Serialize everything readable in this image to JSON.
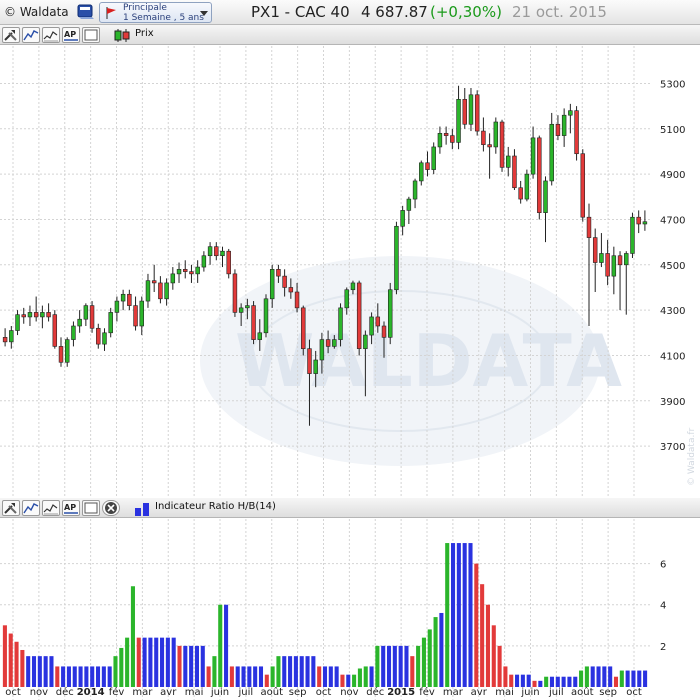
{
  "app": {
    "brand": "© Waldata",
    "scope_line1": "Principale",
    "scope_line2": "1 Semaine , 5 ans",
    "symbol": "PX1 - CAC 40",
    "last": "4 687.87",
    "change": "(+0,30%)",
    "date": "21 oct. 2015"
  },
  "toolbar_top": {
    "legend_label": "Prix"
  },
  "toolbar_bottom": {
    "legend_label": "Indicateur Ratio H/B(14)"
  },
  "watermark": {
    "text": "WALDATA",
    "copyright": "© Waldata.fr"
  },
  "colors": {
    "up": "#2bb52b",
    "down": "#e23a3a",
    "ratio_up": "#2bb52b",
    "ratio_down": "#e23a3a",
    "ratio_neutral": "#2a32e0",
    "accent_change": "#1a9a1a"
  },
  "icons": [
    "hammer-wrench-icon",
    "line-chart-icon",
    "indicator-chart-icon",
    "ap-text-icon",
    "blank-box-icon",
    "close-circle-icon",
    "book-icon",
    "flag-icon"
  ],
  "chart_data": [
    {
      "type": "candlestick",
      "title": "PX1 - CAC 40",
      "series_name": "Prix",
      "y_ticks": [
        3700,
        3900,
        4100,
        4300,
        4500,
        4700,
        4900,
        5100,
        5300
      ],
      "ylim": [
        3480,
        5430
      ],
      "grid": true,
      "x_tick_labels": [
        "oct",
        "nov",
        "déc",
        "2014",
        "fév",
        "mar",
        "avr",
        "mai",
        "juin",
        "juil",
        "août",
        "sep",
        "oct",
        "nov",
        "déc",
        "2015",
        "fév",
        "mar",
        "avr",
        "mai",
        "juin",
        "juil",
        "août",
        "sep",
        "oct"
      ],
      "candles": [
        [
          4180,
          4220,
          4140,
          4160
        ],
        [
          4160,
          4230,
          4130,
          4210
        ],
        [
          4210,
          4300,
          4190,
          4280
        ],
        [
          4280,
          4310,
          4240,
          4270
        ],
        [
          4270,
          4320,
          4230,
          4290
        ],
        [
          4290,
          4360,
          4250,
          4270
        ],
        [
          4270,
          4320,
          4220,
          4290
        ],
        [
          4290,
          4330,
          4250,
          4270
        ],
        [
          4280,
          4300,
          4130,
          4140
        ],
        [
          4140,
          4180,
          4050,
          4070
        ],
        [
          4070,
          4180,
          4050,
          4170
        ],
        [
          4170,
          4250,
          4140,
          4230
        ],
        [
          4230,
          4300,
          4200,
          4260
        ],
        [
          4260,
          4330,
          4230,
          4320
        ],
        [
          4320,
          4340,
          4200,
          4220
        ],
        [
          4220,
          4240,
          4130,
          4150
        ],
        [
          4150,
          4220,
          4120,
          4200
        ],
        [
          4200,
          4310,
          4180,
          4290
        ],
        [
          4290,
          4360,
          4250,
          4340
        ],
        [
          4340,
          4390,
          4300,
          4370
        ],
        [
          4370,
          4390,
          4300,
          4320
        ],
        [
          4320,
          4360,
          4210,
          4230
        ],
        [
          4230,
          4360,
          4190,
          4340
        ],
        [
          4340,
          4460,
          4310,
          4430
        ],
        [
          4430,
          4500,
          4380,
          4420
        ],
        [
          4420,
          4450,
          4330,
          4350
        ],
        [
          4350,
          4440,
          4320,
          4420
        ],
        [
          4420,
          4490,
          4390,
          4460
        ],
        [
          4460,
          4510,
          4420,
          4480
        ],
        [
          4480,
          4520,
          4440,
          4470
        ],
        [
          4470,
          4500,
          4420,
          4460
        ],
        [
          4460,
          4520,
          4420,
          4490
        ],
        [
          4490,
          4560,
          4470,
          4540
        ],
        [
          4540,
          4600,
          4500,
          4580
        ],
        [
          4580,
          4600,
          4520,
          4540
        ],
        [
          4540,
          4580,
          4490,
          4560
        ],
        [
          4560,
          4570,
          4440,
          4460
        ],
        [
          4460,
          4480,
          4270,
          4290
        ],
        [
          4290,
          4330,
          4230,
          4310
        ],
        [
          4310,
          4350,
          4260,
          4320
        ],
        [
          4320,
          4340,
          4150,
          4170
        ],
        [
          4170,
          4260,
          4120,
          4200
        ],
        [
          4200,
          4370,
          4180,
          4350
        ],
        [
          4350,
          4500,
          4310,
          4480
        ],
        [
          4480,
          4500,
          4420,
          4450
        ],
        [
          4450,
          4480,
          4360,
          4400
        ],
        [
          4400,
          4440,
          4350,
          4380
        ],
        [
          4380,
          4420,
          4290,
          4310
        ],
        [
          4310,
          4320,
          4100,
          4130
        ],
        [
          4130,
          4170,
          3790,
          4020
        ],
        [
          4020,
          4120,
          3960,
          4080
        ],
        [
          4080,
          4200,
          4020,
          4170
        ],
        [
          4170,
          4210,
          4110,
          4140
        ],
        [
          4140,
          4190,
          4130,
          4170
        ],
        [
          4170,
          4330,
          4140,
          4310
        ],
        [
          4310,
          4400,
          4280,
          4390
        ],
        [
          4390,
          4430,
          4370,
          4420
        ],
        [
          4420,
          4430,
          4100,
          4130
        ],
        [
          4130,
          4210,
          3920,
          4190
        ],
        [
          4190,
          4290,
          4150,
          4270
        ],
        [
          4270,
          4330,
          4200,
          4230
        ],
        [
          4230,
          4250,
          4090,
          4180
        ],
        [
          4180,
          4420,
          4150,
          4390
        ],
        [
          4390,
          4690,
          4370,
          4670
        ],
        [
          4670,
          4760,
          4630,
          4740
        ],
        [
          4740,
          4800,
          4680,
          4790
        ],
        [
          4790,
          4880,
          4750,
          4870
        ],
        [
          4870,
          4960,
          4850,
          4950
        ],
        [
          4950,
          5000,
          4890,
          4920
        ],
        [
          4920,
          5040,
          4900,
          5020
        ],
        [
          5020,
          5110,
          4990,
          5080
        ],
        [
          5080,
          5110,
          5030,
          5070
        ],
        [
          5070,
          5100,
          5010,
          5040
        ],
        [
          5040,
          5290,
          5010,
          5230
        ],
        [
          5230,
          5280,
          5100,
          5120
        ],
        [
          5120,
          5280,
          5090,
          5250
        ],
        [
          5250,
          5270,
          5070,
          5090
        ],
        [
          5090,
          5150,
          5000,
          5030
        ],
        [
          5030,
          5080,
          4880,
          5020
        ],
        [
          5020,
          5150,
          4990,
          5130
        ],
        [
          5130,
          5140,
          4910,
          4930
        ],
        [
          4930,
          5020,
          4890,
          4980
        ],
        [
          4980,
          5010,
          4830,
          4840
        ],
        [
          4840,
          4870,
          4770,
          4790
        ],
        [
          4790,
          4920,
          4780,
          4900
        ],
        [
          4900,
          5110,
          4880,
          5060
        ],
        [
          5060,
          5070,
          4700,
          4730
        ],
        [
          4730,
          4890,
          4600,
          4870
        ],
        [
          4870,
          5170,
          4850,
          5120
        ],
        [
          5120,
          5160,
          5050,
          5070
        ],
        [
          5070,
          5190,
          5020,
          5160
        ],
        [
          5160,
          5210,
          5080,
          5180
        ],
        [
          5180,
          5200,
          4960,
          4990
        ],
        [
          4990,
          5010,
          4690,
          4710
        ],
        [
          4710,
          4770,
          4230,
          4620
        ],
        [
          4620,
          4660,
          4380,
          4510
        ],
        [
          4510,
          4640,
          4490,
          4550
        ],
        [
          4550,
          4610,
          4410,
          4450
        ],
        [
          4450,
          4580,
          4370,
          4540
        ],
        [
          4540,
          4560,
          4300,
          4500
        ],
        [
          4500,
          4560,
          4280,
          4550
        ],
        [
          4550,
          4730,
          4530,
          4710
        ],
        [
          4710,
          4740,
          4640,
          4680
        ],
        [
          4680,
          4740,
          4650,
          4690
        ]
      ]
    },
    {
      "type": "bar",
      "title": "Indicateur Ratio H/B(14)",
      "series_name": "Indicateur Ratio H/B(14)",
      "y_ticks": [
        2,
        4,
        6
      ],
      "ylim": [
        0,
        7.1
      ],
      "grid": true,
      "bars": [
        [
          3.0,
          "d"
        ],
        [
          2.6,
          "d"
        ],
        [
          2.2,
          "d"
        ],
        [
          1.8,
          "d"
        ],
        [
          1.5,
          "n"
        ],
        [
          1.5,
          "n"
        ],
        [
          1.5,
          "n"
        ],
        [
          1.5,
          "n"
        ],
        [
          1.5,
          "n"
        ],
        [
          1.0,
          "d"
        ],
        [
          1.0,
          "n"
        ],
        [
          1.0,
          "n"
        ],
        [
          1.0,
          "n"
        ],
        [
          1.0,
          "n"
        ],
        [
          1.0,
          "n"
        ],
        [
          1.0,
          "n"
        ],
        [
          1.0,
          "n"
        ],
        [
          1.0,
          "n"
        ],
        [
          1.0,
          "n"
        ],
        [
          1.5,
          "u"
        ],
        [
          1.9,
          "u"
        ],
        [
          2.4,
          "u"
        ],
        [
          4.9,
          "u"
        ],
        [
          2.4,
          "d"
        ],
        [
          2.4,
          "n"
        ],
        [
          2.4,
          "n"
        ],
        [
          2.4,
          "n"
        ],
        [
          2.4,
          "n"
        ],
        [
          2.4,
          "n"
        ],
        [
          2.4,
          "n"
        ],
        [
          2.0,
          "d"
        ],
        [
          2.0,
          "n"
        ],
        [
          2.0,
          "n"
        ],
        [
          2.0,
          "n"
        ],
        [
          2.0,
          "n"
        ],
        [
          1.0,
          "d"
        ],
        [
          1.5,
          "u"
        ],
        [
          4.0,
          "u"
        ],
        [
          4.0,
          "n"
        ],
        [
          1.0,
          "d"
        ],
        [
          1.0,
          "n"
        ],
        [
          1.0,
          "n"
        ],
        [
          1.0,
          "n"
        ],
        [
          1.0,
          "n"
        ],
        [
          1.0,
          "n"
        ],
        [
          0.6,
          "d"
        ],
        [
          1.0,
          "u"
        ],
        [
          1.5,
          "u"
        ],
        [
          1.5,
          "n"
        ],
        [
          1.5,
          "n"
        ],
        [
          1.5,
          "n"
        ],
        [
          1.5,
          "n"
        ],
        [
          1.5,
          "n"
        ],
        [
          1.5,
          "n"
        ],
        [
          1.0,
          "d"
        ],
        [
          1.0,
          "n"
        ],
        [
          1.0,
          "n"
        ],
        [
          1.0,
          "n"
        ],
        [
          0.6,
          "d"
        ],
        [
          0.6,
          "n"
        ],
        [
          0.6,
          "u"
        ],
        [
          0.9,
          "u"
        ],
        [
          1.0,
          "u"
        ],
        [
          1.0,
          "n"
        ],
        [
          2.0,
          "u"
        ],
        [
          2.0,
          "n"
        ],
        [
          2.0,
          "n"
        ],
        [
          2.0,
          "n"
        ],
        [
          2.0,
          "n"
        ],
        [
          2.0,
          "n"
        ],
        [
          1.5,
          "d"
        ],
        [
          2.0,
          "u"
        ],
        [
          2.4,
          "u"
        ],
        [
          2.8,
          "u"
        ],
        [
          3.4,
          "u"
        ],
        [
          3.6,
          "n"
        ],
        [
          7.0,
          "u"
        ],
        [
          7.0,
          "n"
        ],
        [
          7.0,
          "n"
        ],
        [
          7.0,
          "n"
        ],
        [
          7.0,
          "n"
        ],
        [
          6.0,
          "d"
        ],
        [
          5.0,
          "d"
        ],
        [
          4.0,
          "d"
        ],
        [
          3.0,
          "d"
        ],
        [
          2.0,
          "d"
        ],
        [
          1.0,
          "d"
        ],
        [
          0.6,
          "d"
        ],
        [
          0.6,
          "n"
        ],
        [
          0.6,
          "n"
        ],
        [
          0.6,
          "n"
        ],
        [
          0.3,
          "d"
        ],
        [
          0.3,
          "n"
        ],
        [
          0.5,
          "u"
        ],
        [
          0.5,
          "n"
        ],
        [
          0.5,
          "n"
        ],
        [
          0.5,
          "n"
        ],
        [
          0.5,
          "n"
        ],
        [
          0.5,
          "n"
        ],
        [
          0.8,
          "u"
        ],
        [
          1.0,
          "u"
        ],
        [
          1.0,
          "n"
        ],
        [
          1.0,
          "n"
        ],
        [
          1.0,
          "n"
        ],
        [
          1.0,
          "n"
        ],
        [
          0.5,
          "d"
        ],
        [
          0.8,
          "u"
        ],
        [
          0.8,
          "n"
        ],
        [
          0.8,
          "n"
        ],
        [
          0.8,
          "n"
        ],
        [
          0.8,
          "n"
        ]
      ]
    }
  ]
}
